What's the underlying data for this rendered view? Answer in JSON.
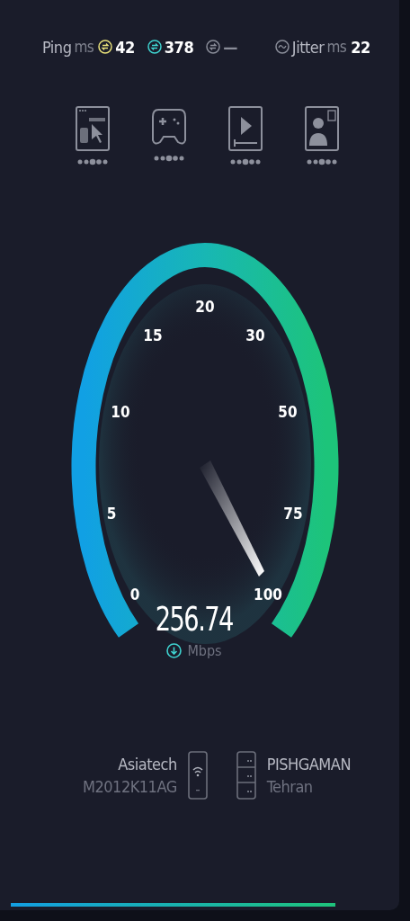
{
  "stats": [
    {
      "kind": "ping",
      "label": "Ping",
      "unit": "ms",
      "value": "42",
      "color": "#e8e07a"
    },
    {
      "kind": "download",
      "value": "378",
      "color": "#3fd3d0"
    },
    {
      "kind": "upload",
      "value": "—",
      "color": "#8a8d99"
    },
    {
      "kind": "jitter",
      "label": "Jitter",
      "unit": "ms",
      "value": "22",
      "color": "#8a8d99"
    }
  ],
  "activities": [
    {
      "kind": "browsing"
    },
    {
      "kind": "gaming"
    },
    {
      "kind": "video"
    },
    {
      "kind": "call"
    }
  ],
  "gauge": {
    "scale": [
      "0",
      "5",
      "10",
      "15",
      "20",
      "30",
      "50",
      "75",
      "100"
    ],
    "speed": "256.74",
    "unit": "Mbps"
  },
  "connection": {
    "provider": "Asiatech",
    "device": "M2012K11AG",
    "server": "PISHGAMAN",
    "city": "Tehran"
  },
  "progress": {
    "level": 0.86
  }
}
